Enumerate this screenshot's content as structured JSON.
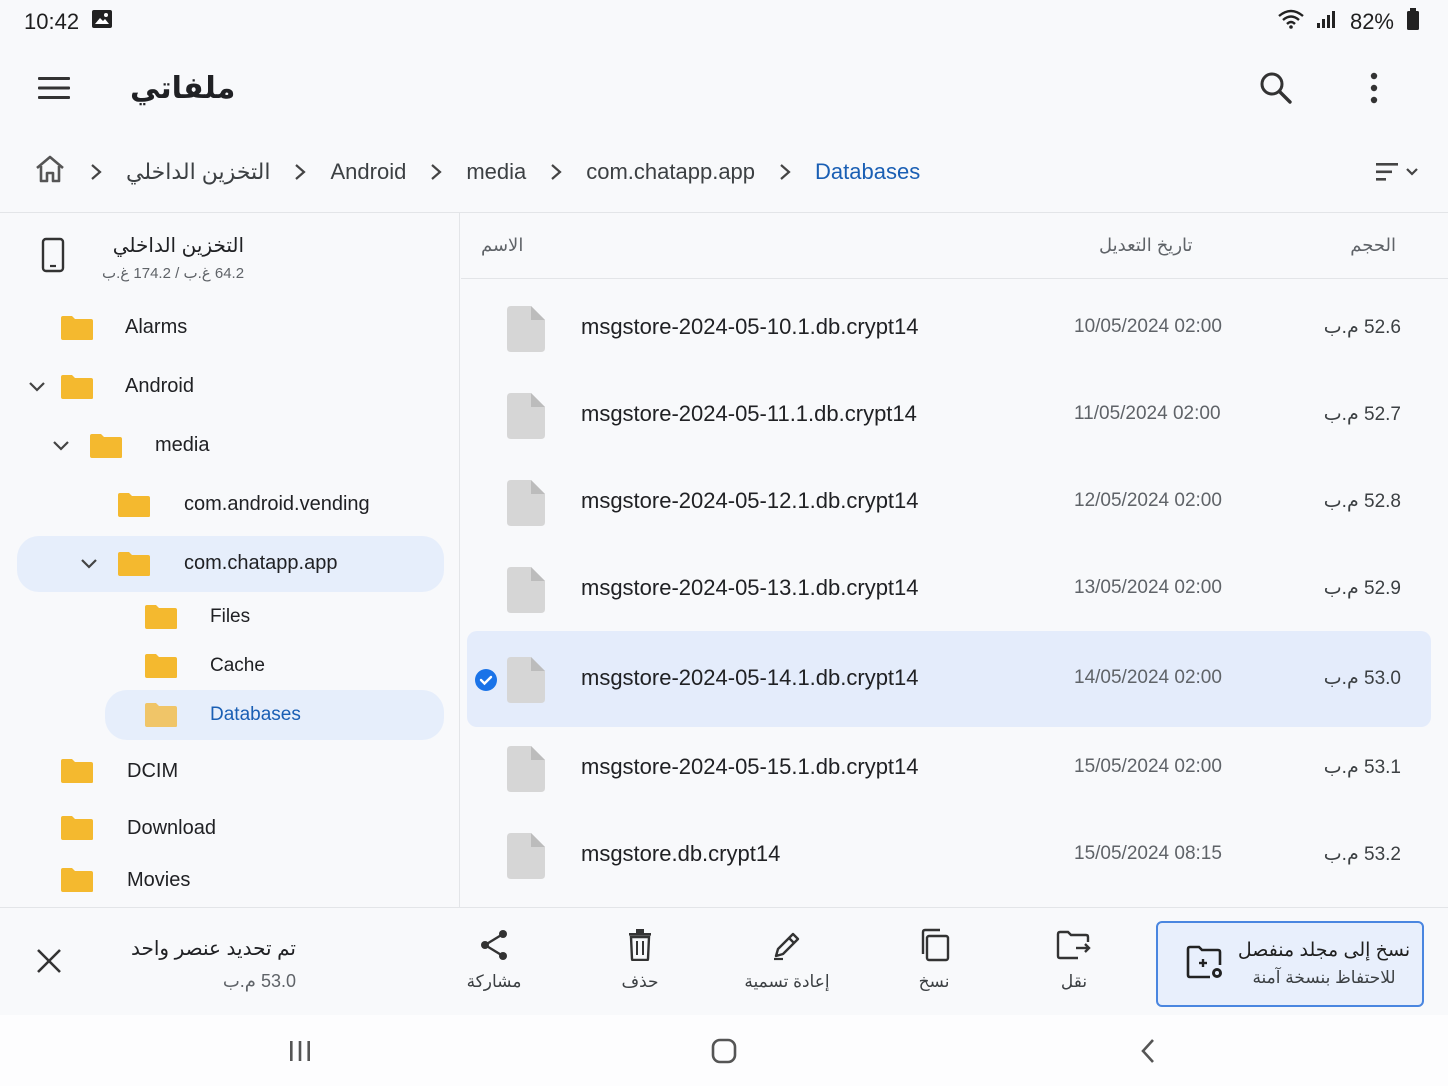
{
  "status_bar": {
    "time": "10:42",
    "battery": "82%"
  },
  "app_bar": {
    "title": "ملفاتي"
  },
  "breadcrumb": [
    "التخزين الداخلي",
    "Android",
    "media",
    "com.chatapp.app",
    "Databases"
  ],
  "sidebar": {
    "storage": {
      "name": "التخزين الداخلي",
      "usage": "64.2 غ.ب / 174.2 غ.ب"
    },
    "tree": [
      {
        "label": "Alarms"
      },
      {
        "label": "Android"
      },
      {
        "label": "media"
      },
      {
        "label": "com.android.vending"
      },
      {
        "label": "com.chatapp.app"
      },
      {
        "label": "Files"
      },
      {
        "label": "Cache"
      },
      {
        "label": "Databases"
      },
      {
        "label": "DCIM"
      },
      {
        "label": "Download"
      },
      {
        "label": "Movies"
      }
    ]
  },
  "columns": {
    "name": "الاسم",
    "date": "تاريخ التعديل",
    "size": "الحجم"
  },
  "files": [
    {
      "name": "msgstore-2024-05-10.1.db.crypt14",
      "date": "10/05/2024 02:00",
      "size": "52.6 م.ب",
      "selected": false
    },
    {
      "name": "msgstore-2024-05-11.1.db.crypt14",
      "date": "11/05/2024 02:00",
      "size": "52.7 م.ب",
      "selected": false
    },
    {
      "name": "msgstore-2024-05-12.1.db.crypt14",
      "date": "12/05/2024 02:00",
      "size": "52.8 م.ب",
      "selected": false
    },
    {
      "name": "msgstore-2024-05-13.1.db.crypt14",
      "date": "13/05/2024 02:00",
      "size": "52.9 م.ب",
      "selected": false
    },
    {
      "name": "msgstore-2024-05-14.1.db.crypt14",
      "date": "14/05/2024 02:00",
      "size": "53.0 م.ب",
      "selected": true
    },
    {
      "name": "msgstore-2024-05-15.1.db.crypt14",
      "date": "15/05/2024 02:00",
      "size": "53.1 م.ب",
      "selected": false
    },
    {
      "name": "msgstore.db.crypt14",
      "date": "15/05/2024 08:15",
      "size": "53.2 م.ب",
      "selected": false
    }
  ],
  "selection": {
    "title": "تم تحديد عنصر واحد",
    "size": "53.0 م.ب"
  },
  "actions": {
    "share": "مشاركة",
    "delete": "حذف",
    "rename": "إعادة تسمية",
    "copy": "نسخ",
    "move": "نقل"
  },
  "secure_copy": {
    "line1": "نسخ إلى مجلد منفصل",
    "line2": "للاحتفاظ بنسخة آمنة"
  },
  "colors": {
    "accent": "#1a73e8",
    "folder": "#f4b92f",
    "selected_bg": "#e4ecfb"
  }
}
